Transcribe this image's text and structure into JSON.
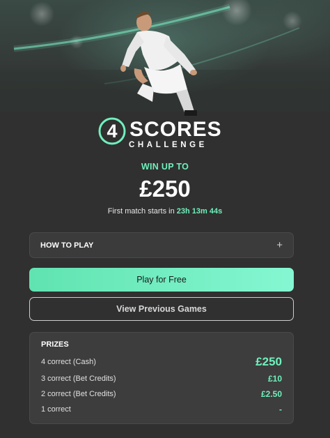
{
  "hero": {
    "logo_number": "4",
    "logo_title": "SCORES",
    "logo_subtitle": "CHALLENGE",
    "win_label": "WIN UP TO",
    "win_amount": "£250",
    "first_match_prefix": "First match starts in",
    "first_match_timer": "23h 13m 44s"
  },
  "how_to_play": {
    "label": "HOW TO PLAY",
    "expand_icon": "+"
  },
  "buttons": {
    "play_free": "Play for Free",
    "view_previous": "View Previous Games"
  },
  "prizes": {
    "title": "PRIZES",
    "rows": [
      {
        "label": "4 correct (Cash)",
        "value": "£250"
      },
      {
        "label": "3 correct (Bet Credits)",
        "value": "£10"
      },
      {
        "label": "2 correct (Bet Credits)",
        "value": "£2.50"
      },
      {
        "label": "1 correct",
        "value": "-"
      }
    ]
  },
  "colors": {
    "background": "#303030",
    "accent_green": "#6ff0bd",
    "card": "#3d3d3d"
  }
}
